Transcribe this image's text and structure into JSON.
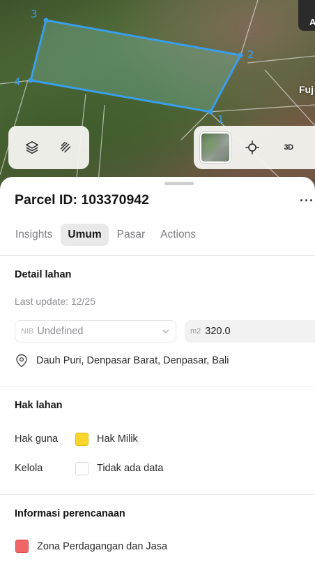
{
  "map": {
    "vertex_labels": [
      "1",
      "2",
      "3",
      "4"
    ],
    "corner_chip_label": "A",
    "place_label": "Fuj",
    "mode_3d_label": "3D",
    "parcel_color": "#3a9ee8",
    "icons": [
      "layers-icon",
      "route-icon",
      "crosshair-icon"
    ]
  },
  "sheet": {
    "title": "Parcel ID: 103370942",
    "more_label": "···",
    "tabs": [
      {
        "label": "Insights",
        "active": false
      },
      {
        "label": "Umum",
        "active": true
      },
      {
        "label": "Pasar",
        "active": false
      },
      {
        "label": "Actions",
        "active": false
      }
    ]
  },
  "detail": {
    "heading": "Detail lahan",
    "last_update": "Last update: 12/25",
    "nib_prefix": "NIB",
    "nib_value": "Undefined",
    "area_unit": "m2",
    "area_value": "320.0",
    "location": "Dauh Puri, Denpasar Barat, Denpasar, Bali"
  },
  "rights": {
    "heading": "Hak lahan",
    "rows": [
      {
        "label": "Hak guna",
        "value": "Hak Milik",
        "color": "#f7d52c"
      },
      {
        "label": "Kelola",
        "value": "Tidak ada data",
        "color": "#ffffff"
      }
    ]
  },
  "planning": {
    "heading": "Informasi perencanaan",
    "zone": "Zona Perdagangan dan Jasa",
    "zone_color": "#f06565"
  }
}
